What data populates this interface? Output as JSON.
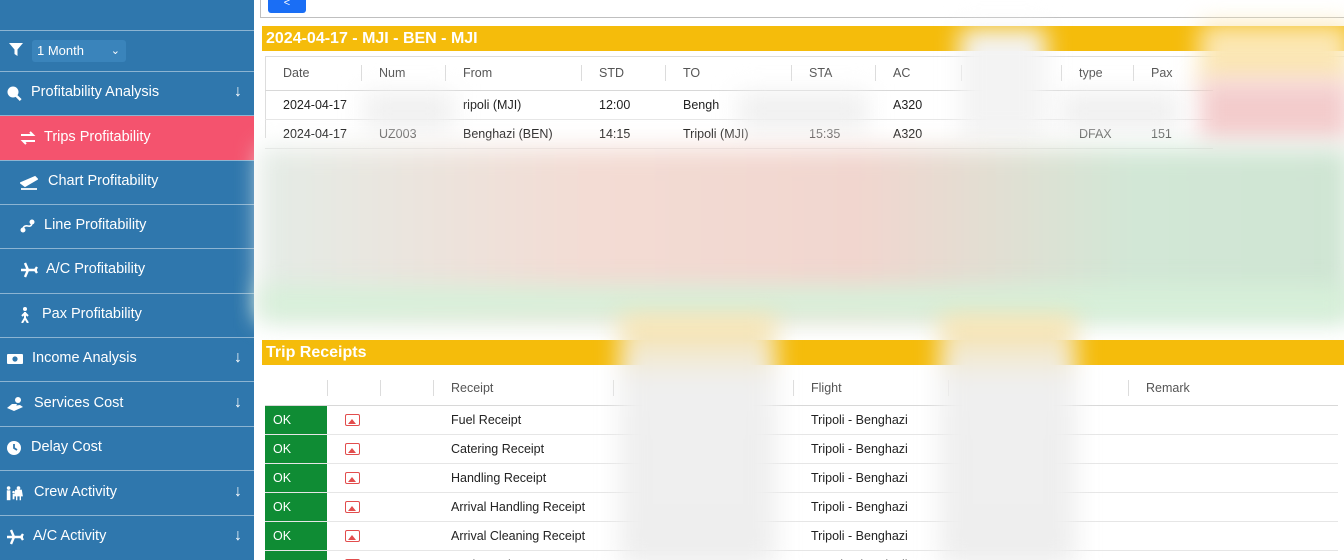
{
  "sidebar": {
    "period": {
      "selected": "1 Month"
    },
    "items": [
      {
        "label": "Profitability Analysis",
        "icon": "search-chart-icon",
        "has_arrow": true
      },
      {
        "label": "Trips Profitability",
        "icon": "swap-arrows-icon",
        "active": true
      },
      {
        "label": "Chart Profitability",
        "icon": "plane-departure-icon"
      },
      {
        "label": "Line Profitability",
        "icon": "route-icon"
      },
      {
        "label": "A/C Profitability",
        "icon": "plane-icon"
      },
      {
        "label": "Pax Profitability",
        "icon": "person-walking-icon"
      },
      {
        "label": "Income Analysis",
        "icon": "money-icon",
        "has_arrow": true
      },
      {
        "label": "Services Cost",
        "icon": "hand-coins-icon",
        "has_arrow": true
      },
      {
        "label": "Delay Cost",
        "icon": "clock-icon"
      },
      {
        "label": "Crew Activity",
        "icon": "people-icon",
        "has_arrow": true
      },
      {
        "label": "A/C Activity",
        "icon": "plane-icon",
        "has_arrow": true
      }
    ],
    "arrow_glyph": "↓"
  },
  "main": {
    "back_button": "<",
    "trip_title": "2024-04-17 - MJI - BEN - MJI",
    "trip_columns": [
      "Date",
      "Num",
      "From",
      "STD",
      "TO",
      "STA",
      "AC",
      "",
      "type",
      "Pax"
    ],
    "trip_rows": [
      {
        "date": "2024-04-17",
        "num": "",
        "from": "ripoli (MJI)",
        "std": "12:00",
        "to": "Bengh",
        "sta": "",
        "ac": "A320",
        "type": "",
        "pax": ""
      },
      {
        "date": "2024-04-17",
        "num": "UZ003",
        "from": "Benghazi (BEN)",
        "std": "14:15",
        "to": "Tripoli (MJI)",
        "sta": "15:35",
        "ac": "A320",
        "type": "DFAX",
        "pax": "151"
      }
    ],
    "receipts_title": "Trip Receipts",
    "receipt_columns": [
      "",
      "",
      "",
      "Receipt",
      "",
      "Flight",
      "",
      "Remark"
    ],
    "receipt_rows": [
      {
        "status": "OK",
        "receipt": "Fuel Receipt",
        "flight": "Tripoli - Benghazi"
      },
      {
        "status": "OK",
        "receipt": "Catering Receipt",
        "flight": "Tripoli - Benghazi"
      },
      {
        "status": "OK",
        "receipt": "Handling Receipt",
        "flight": "Tripoli - Benghazi"
      },
      {
        "status": "OK",
        "receipt": "Arrival Handling Receipt",
        "flight": "Tripoli - Benghazi"
      },
      {
        "status": "OK",
        "receipt": "Arrival Cleaning Receipt",
        "flight": "Tripoli - Benghazi"
      },
      {
        "status": "OK",
        "receipt": "Fuel Receipt",
        "flight": "Benghazi - Tripoli"
      }
    ]
  },
  "colors": {
    "sidebar": "#2f77ad",
    "active": "#f4536e",
    "section_bar": "#f5bc0b",
    "ok": "#0f8c34",
    "primary": "#1a6ef5"
  }
}
